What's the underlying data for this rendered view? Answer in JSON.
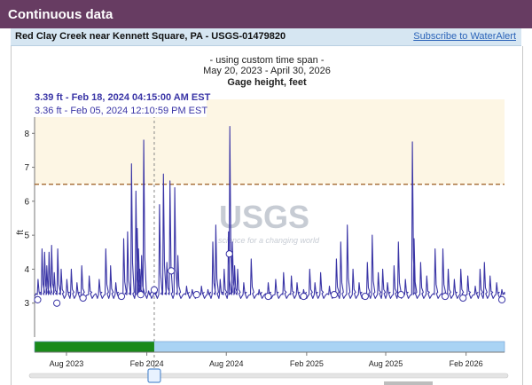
{
  "header": {
    "title": "Continuous data"
  },
  "station": {
    "name": "Red Clay Creek near Kennett Square, PA - USGS-01479820",
    "alert_link": "Subscribe to WaterAlert"
  },
  "caption": {
    "line1": "- using custom time span -",
    "line2": "May 20, 2023 - April 30, 2026",
    "line3": "Gage height, feet"
  },
  "tooltip": {
    "line1": "3.39 ft - Feb 18, 2024 04:15:00 AM EST",
    "line2": "3.36 ft - Feb 05, 2024 12:10:59 PM EST"
  },
  "watermark": {
    "logo": "USGS",
    "tagline": "science for a changing world"
  },
  "colors": {
    "header": "#673c62",
    "line": "#3a35a6",
    "threshold": "#9b5b1e",
    "above_fill": "#fdf6e4",
    "approved_bar": "#1a8a1a",
    "provisional_bar": "#a9d3f4",
    "watermark": "#c7ccd4"
  },
  "chart_data": {
    "type": "line",
    "title": "Gage height, feet",
    "ylabel": "ft",
    "ylim": [
      2.0,
      9.0
    ],
    "yticks": [
      3,
      4,
      5,
      6,
      7,
      8
    ],
    "xlim": [
      "2023-05-20",
      "2026-04-30"
    ],
    "xticks": [
      "2023-08-01",
      "2024-02-01",
      "2024-08-01",
      "2025-02-01",
      "2025-08-01",
      "2026-02-01"
    ],
    "xtick_labels": [
      "Aug 2023",
      "Feb 2024",
      "Aug 2024",
      "Feb 2025",
      "Aug 2025",
      "Feb 2026"
    ],
    "threshold": 6.5,
    "cursor_date": "2024-02-18",
    "series": [
      {
        "baseline": 3.2,
        "peaks": [
          {
            "date": "2023-05-28",
            "value": 3.7
          },
          {
            "date": "2023-06-06",
            "value": 4.6
          },
          {
            "date": "2023-06-12",
            "value": 4.5
          },
          {
            "date": "2023-06-17",
            "value": 4.1
          },
          {
            "date": "2023-06-22",
            "value": 4.5
          },
          {
            "date": "2023-06-28",
            "value": 4.7
          },
          {
            "date": "2023-07-04",
            "value": 3.9
          },
          {
            "date": "2023-07-12",
            "value": 4.6
          },
          {
            "date": "2023-07-20",
            "value": 4.0
          },
          {
            "date": "2023-08-02",
            "value": 3.7
          },
          {
            "date": "2023-08-12",
            "value": 4.0
          },
          {
            "date": "2023-08-25",
            "value": 3.6
          },
          {
            "date": "2023-09-05",
            "value": 4.1
          },
          {
            "date": "2023-09-22",
            "value": 3.8
          },
          {
            "date": "2023-10-15",
            "value": 3.7
          },
          {
            "date": "2023-10-30",
            "value": 4.6
          },
          {
            "date": "2023-11-10",
            "value": 4.1
          },
          {
            "date": "2023-11-22",
            "value": 3.6
          },
          {
            "date": "2023-12-10",
            "value": 4.9
          },
          {
            "date": "2023-12-19",
            "value": 5.1
          },
          {
            "date": "2023-12-28",
            "value": 7.1
          },
          {
            "date": "2024-01-07",
            "value": 6.3
          },
          {
            "date": "2024-01-10",
            "value": 5.2
          },
          {
            "date": "2024-01-13",
            "value": 4.6
          },
          {
            "date": "2024-01-16",
            "value": 4.0
          },
          {
            "date": "2024-01-20",
            "value": 4.4
          },
          {
            "date": "2024-01-25",
            "value": 7.8
          },
          {
            "date": "2024-02-05",
            "value": 3.36
          },
          {
            "date": "2024-02-18",
            "value": 3.39
          },
          {
            "date": "2024-03-01",
            "value": 5.9
          },
          {
            "date": "2024-03-10",
            "value": 6.8
          },
          {
            "date": "2024-03-18",
            "value": 4.2
          },
          {
            "date": "2024-03-25",
            "value": 6.6
          },
          {
            "date": "2024-04-05",
            "value": 6.4
          },
          {
            "date": "2024-04-12",
            "value": 4.4
          },
          {
            "date": "2024-05-02",
            "value": 3.5
          },
          {
            "date": "2024-05-15",
            "value": 3.4
          },
          {
            "date": "2024-06-05",
            "value": 3.5
          },
          {
            "date": "2024-06-20",
            "value": 3.4
          },
          {
            "date": "2024-07-01",
            "value": 4.8
          },
          {
            "date": "2024-07-08",
            "value": 5.3
          },
          {
            "date": "2024-07-18",
            "value": 3.7
          },
          {
            "date": "2024-07-27",
            "value": 4.0
          },
          {
            "date": "2024-08-06",
            "value": 5.1
          },
          {
            "date": "2024-08-09",
            "value": 8.2
          },
          {
            "date": "2024-08-15",
            "value": 4.8
          },
          {
            "date": "2024-08-20",
            "value": 4.1
          },
          {
            "date": "2024-08-27",
            "value": 4.0
          },
          {
            "date": "2024-09-10",
            "value": 3.6
          },
          {
            "date": "2024-09-27",
            "value": 4.3
          },
          {
            "date": "2024-10-15",
            "value": 3.4
          },
          {
            "date": "2024-11-05",
            "value": 3.6
          },
          {
            "date": "2024-11-22",
            "value": 3.7
          },
          {
            "date": "2024-12-10",
            "value": 3.9
          },
          {
            "date": "2024-12-28",
            "value": 3.8
          },
          {
            "date": "2025-01-10",
            "value": 3.6
          },
          {
            "date": "2025-01-25",
            "value": 3.4
          },
          {
            "date": "2025-02-08",
            "value": 4.0
          },
          {
            "date": "2025-02-20",
            "value": 3.6
          },
          {
            "date": "2025-03-05",
            "value": 3.9
          },
          {
            "date": "2025-03-25",
            "value": 3.5
          },
          {
            "date": "2025-04-10",
            "value": 4.3
          },
          {
            "date": "2025-04-20",
            "value": 4.8
          },
          {
            "date": "2025-05-05",
            "value": 5.3
          },
          {
            "date": "2025-05-18",
            "value": 4.0
          },
          {
            "date": "2025-06-01",
            "value": 3.6
          },
          {
            "date": "2025-06-20",
            "value": 4.2
          },
          {
            "date": "2025-07-01",
            "value": 5.0
          },
          {
            "date": "2025-07-15",
            "value": 3.9
          },
          {
            "date": "2025-07-25",
            "value": 4.0
          },
          {
            "date": "2025-08-05",
            "value": 3.6
          },
          {
            "date": "2025-08-20",
            "value": 4.1
          },
          {
            "date": "2025-08-30",
            "value": 4.8
          },
          {
            "date": "2025-09-15",
            "value": 3.7
          },
          {
            "date": "2025-10-01",
            "value": 7.75
          },
          {
            "date": "2025-10-05",
            "value": 4.9
          },
          {
            "date": "2025-10-20",
            "value": 4.2
          },
          {
            "date": "2025-11-03",
            "value": 3.8
          },
          {
            "date": "2025-11-22",
            "value": 4.6
          },
          {
            "date": "2025-12-10",
            "value": 4.6
          },
          {
            "date": "2025-12-22",
            "value": 4.0
          },
          {
            "date": "2026-01-05",
            "value": 3.7
          },
          {
            "date": "2026-01-20",
            "value": 4.0
          },
          {
            "date": "2026-02-05",
            "value": 3.8
          },
          {
            "date": "2026-02-22",
            "value": 3.5
          },
          {
            "date": "2026-03-05",
            "value": 4.0
          },
          {
            "date": "2026-03-15",
            "value": 4.2
          },
          {
            "date": "2026-03-28",
            "value": 3.8
          },
          {
            "date": "2026-04-12",
            "value": 3.6
          },
          {
            "date": "2026-04-24",
            "value": 3.4
          }
        ]
      }
    ],
    "markers": [
      {
        "date": "2023-05-27",
        "value": 3.1
      },
      {
        "date": "2023-07-10",
        "value": 3.0
      },
      {
        "date": "2023-09-08",
        "value": 3.15
      },
      {
        "date": "2023-12-05",
        "value": 3.2
      },
      {
        "date": "2024-01-18",
        "value": 3.25
      },
      {
        "date": "2024-02-18",
        "value": 3.39
      },
      {
        "date": "2024-03-28",
        "value": 3.95
      },
      {
        "date": "2024-05-25",
        "value": 3.25
      },
      {
        "date": "2024-08-08",
        "value": 4.45
      },
      {
        "date": "2024-11-05",
        "value": 3.2
      },
      {
        "date": "2025-01-25",
        "value": 3.2
      },
      {
        "date": "2025-04-05",
        "value": 3.25
      },
      {
        "date": "2025-06-15",
        "value": 3.2
      },
      {
        "date": "2025-09-05",
        "value": 3.25
      },
      {
        "date": "2025-12-15",
        "value": 3.2
      },
      {
        "date": "2026-01-25",
        "value": 3.15
      },
      {
        "date": "2026-04-24",
        "value": 3.1
      }
    ],
    "approval": [
      {
        "status": "approved",
        "start": "2023-05-20",
        "end": "2024-02-18"
      },
      {
        "status": "provisional",
        "start": "2024-02-18",
        "end": "2026-04-30"
      }
    ],
    "grid": false,
    "legend": "none"
  }
}
